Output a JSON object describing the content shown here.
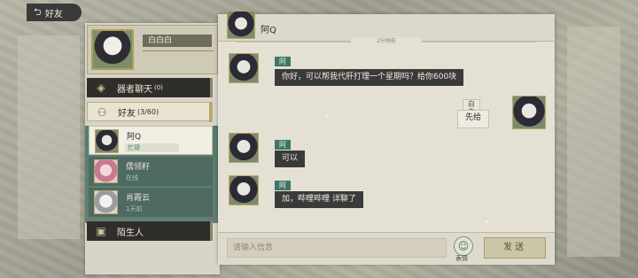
{
  "topbar": {
    "back_label": "好友",
    "back_icon": "return-arrow-icon"
  },
  "profile": {
    "name": "白白白"
  },
  "categories": [
    {
      "label": "器者聊天",
      "count": "(0)",
      "icon": "cube-icon"
    },
    {
      "label": "好友",
      "count": "(3/60)",
      "icon": "friends-icon"
    },
    {
      "label": "陌生人",
      "count": "",
      "icon": "stranger-icon"
    }
  ],
  "friends": [
    {
      "name": "阿Q",
      "status": "忙碌"
    },
    {
      "name": "儒领籽",
      "status": "在线"
    },
    {
      "name": "肖霞云",
      "status": "1天前"
    }
  ],
  "chat": {
    "contact_name": "阿Q",
    "time_divider": "2分钟前",
    "messages": [
      {
        "sender": "阿Q",
        "text": "你好，可以帮我代肝打理一个星期吗？给你600块"
      },
      {
        "sender": "白白白",
        "text": "先给"
      },
      {
        "sender": "阿Q",
        "text": "可以"
      },
      {
        "sender": "阿Q",
        "text": "加，哔哩哔哩  详聊了"
      }
    ]
  },
  "input": {
    "placeholder": "请输入信息",
    "emoji_label": "表情",
    "send_label": "发送"
  },
  "colors": {
    "accent_green": "#3e7665",
    "dark_bubble": "#3a3a3a",
    "gold_frame": "#b09d5c"
  }
}
